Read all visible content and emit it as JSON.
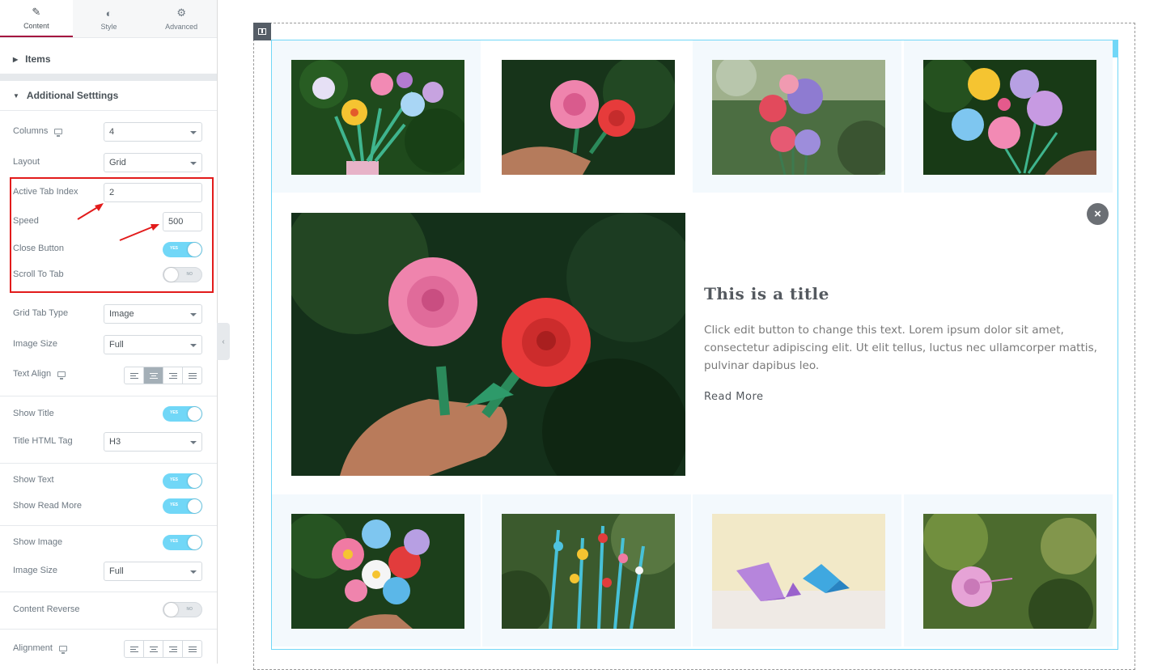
{
  "sidebar": {
    "tabs": [
      {
        "label": "Content",
        "icon": "pencil-icon"
      },
      {
        "label": "Style",
        "icon": "half-circle-icon"
      },
      {
        "label": "Advanced",
        "icon": "gear-icon"
      }
    ],
    "sections": {
      "items": "Items",
      "additional": "Additional Setttings"
    },
    "fields": {
      "columns": {
        "label": "Columns",
        "value": "4"
      },
      "layout": {
        "label": "Layout",
        "value": "Grid"
      },
      "active_tab_index": {
        "label": "Active Tab Index",
        "value": "2"
      },
      "speed": {
        "label": "Speed",
        "value": "500"
      },
      "close_button": {
        "label": "Close Button",
        "state": "YES"
      },
      "scroll_to_tab": {
        "label": "Scroll To Tab",
        "state": "NO"
      },
      "grid_tab_type": {
        "label": "Grid Tab Type",
        "value": "Image"
      },
      "image_size": {
        "label": "Image Size",
        "value": "Full"
      },
      "text_align": {
        "label": "Text Align"
      },
      "show_title": {
        "label": "Show Title",
        "state": "YES"
      },
      "title_html_tag": {
        "label": "Title HTML Tag",
        "value": "H3"
      },
      "show_text": {
        "label": "Show Text",
        "state": "YES"
      },
      "show_read_more": {
        "label": "Show Read More",
        "state": "YES"
      },
      "show_image": {
        "label": "Show Image",
        "state": "YES"
      },
      "image_size_2": {
        "label": "Image Size",
        "value": "Full"
      },
      "content_reverse": {
        "label": "Content Reverse",
        "state": "NO"
      },
      "alignment": {
        "label": "Alignment"
      }
    }
  },
  "canvas": {
    "content": {
      "title": "This is a title",
      "text": "Click edit button to change this text. Lorem ipsum dolor sit amet, consectetur adipiscing elit. Ut elit tellus, luctus nec ullamcorper mattis, pulvinar dapibus leo.",
      "read_more": "Read More",
      "close_icon": "×"
    },
    "colors": {
      "accent": "#71d7f7",
      "highlight": "#e21b1b",
      "active_tab_underline": "#a4123f"
    }
  }
}
